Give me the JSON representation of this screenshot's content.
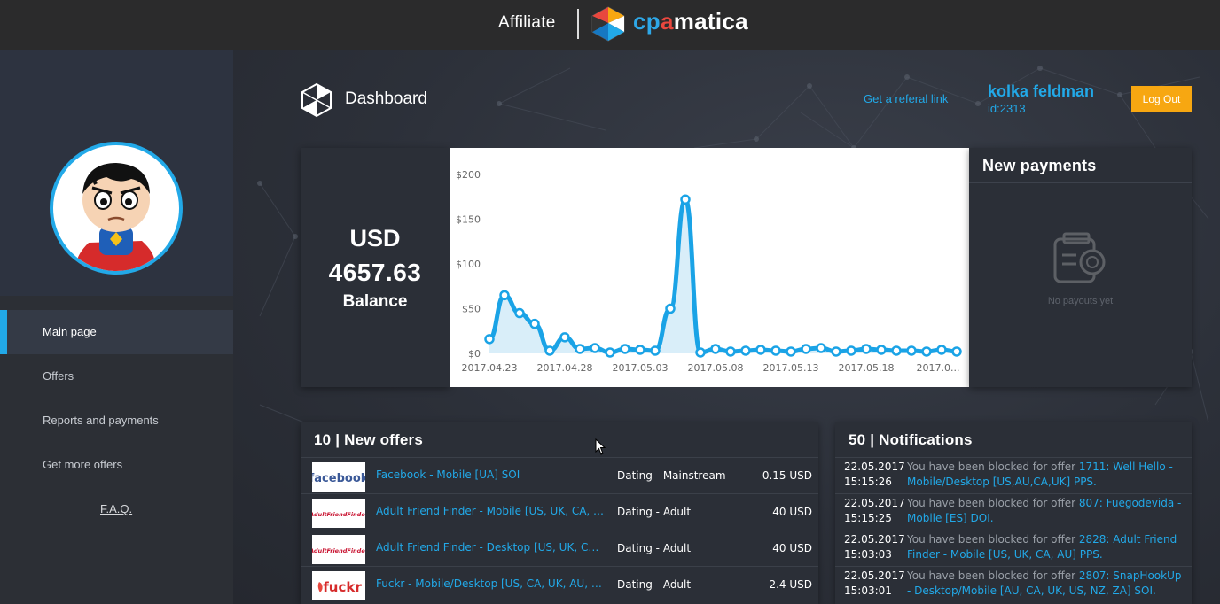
{
  "header": {
    "affiliate_label": "Affiliate",
    "brand": {
      "part1": "cp",
      "part2": "a",
      "part3": "matica"
    }
  },
  "sidebar": {
    "items": [
      {
        "label": "Main page",
        "active": true
      },
      {
        "label": "Offers",
        "active": false
      },
      {
        "label": "Reports and payments",
        "active": false
      },
      {
        "label": "Get more offers",
        "active": false
      }
    ],
    "faq": "F.A.Q."
  },
  "topline": {
    "title": "Dashboard",
    "referral_link": "Get a referal link",
    "user_name": "kolka feldman",
    "user_id": "id:2313",
    "logout": "Log Out"
  },
  "balance": {
    "currency": "USD",
    "amount": "4657.63",
    "label": "Balance"
  },
  "chart_data": {
    "type": "line",
    "ylim": [
      0,
      200
    ],
    "y_ticks": [
      "$200",
      "$150",
      "$100",
      "$50",
      "$0"
    ],
    "x_tick_labels": [
      "2017.04.23",
      "2017.04.28",
      "2017.05.03",
      "2017.05.08",
      "2017.05.13",
      "2017.05.18",
      "2017.0..."
    ],
    "values": [
      16,
      65,
      45,
      33,
      3,
      18,
      5,
      6,
      1,
      5,
      4,
      3,
      50,
      172,
      1,
      5,
      2,
      3,
      4,
      3,
      2,
      5,
      6,
      2,
      3,
      5,
      4,
      3,
      3,
      2,
      4,
      2
    ]
  },
  "payments": {
    "title": "New payments",
    "empty_text": "No payouts yet"
  },
  "offers": {
    "title": "10 | New offers",
    "rows": [
      {
        "logo": "facebook",
        "name": "Facebook - Mobile [UA] SOI",
        "category": "Dating - Mainstream",
        "price": "0.15 USD"
      },
      {
        "logo": "AdultFriendFinder",
        "name": "Adult Friend Finder - Mobile [US, UK, CA, AU]",
        "category": "Dating - Adult",
        "price": "40 USD"
      },
      {
        "logo": "AdultFriendFinder",
        "name": "Adult Friend Finder - Desktop [US, UK, CA, AU]",
        "category": "Dating - Adult",
        "price": "40 USD"
      },
      {
        "logo": "fuckr",
        "name": "Fuckr - Mobile/Desktop [US, CA, UK, AU, NZ]",
        "category": "Dating - Adult",
        "price": "2.4 USD"
      }
    ]
  },
  "notifications": {
    "title": "50 | Notifications",
    "rows": [
      {
        "date": "22.05.2017",
        "time": "15:15:26",
        "text": "You have been blocked for offer ",
        "link": "1711: Well Hello - Mobile/Desktop [US,AU,CA,UK] PPS."
      },
      {
        "date": "22.05.2017",
        "time": "15:15:25",
        "text": "You have been blocked for offer ",
        "link": "807: Fuegodevida - Mobile [ES] DOI."
      },
      {
        "date": "22.05.2017",
        "time": "15:03:03",
        "text": "You have been blocked for offer ",
        "link": "2828: Adult Friend Finder - Mobile [US, UK, CA, AU] PPS."
      },
      {
        "date": "22.05.2017",
        "time": "15:03:01",
        "text": "You have been blocked for offer ",
        "link": "2807: SnapHookUp - Desktop/Mobile [AU, CA, UK, US, NZ, ZA] SOI."
      }
    ]
  }
}
